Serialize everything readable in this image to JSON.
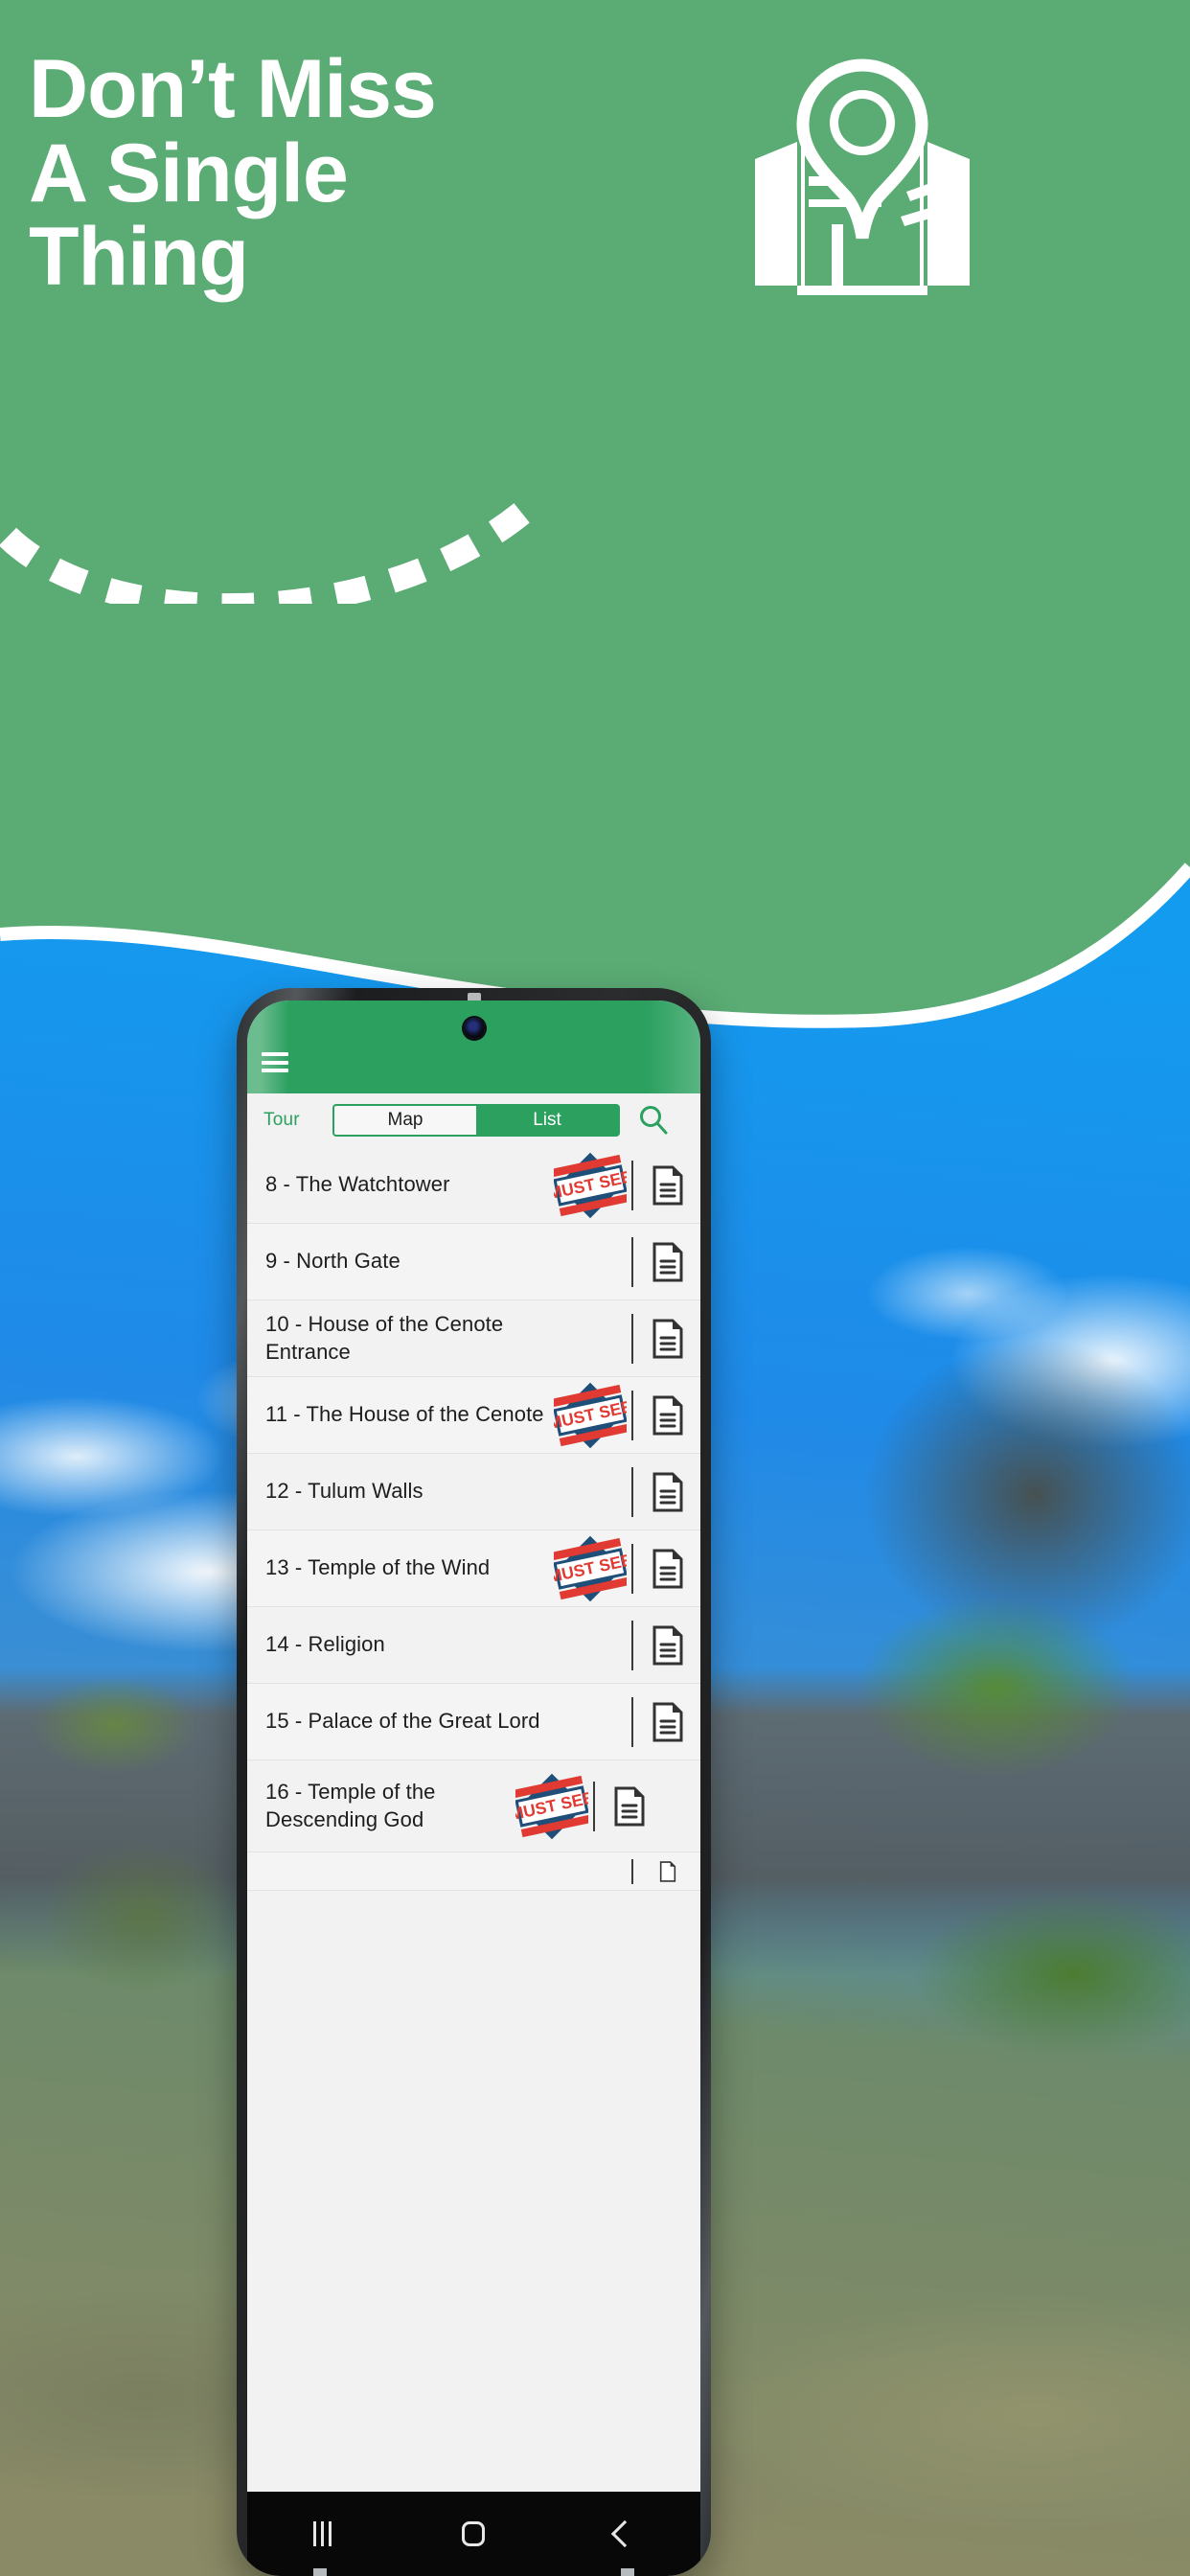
{
  "promo": {
    "headline": "Don’t Miss\nA Single\nThing",
    "background_green": "#5aab74",
    "illustration_icon": "open-book-map-with-location-pin-icon",
    "dashed_arc_icon": "dashed-curve-arc-icon"
  },
  "phone": {
    "app_bar": {
      "background": "#2ba05f",
      "menu_icon": "hamburger-menu-icon",
      "camera_icon": "front-camera-icon"
    },
    "toolbar": {
      "screen_label": "Tour",
      "segments": [
        {
          "label": "Map",
          "selected": true
        },
        {
          "label": "List",
          "selected": false
        }
      ],
      "search_icon": "search-icon"
    },
    "list": {
      "badge_label": "MUST SEE",
      "badge_colors": {
        "diamond": "#1f4e79",
        "banner": "#e03a33",
        "text": "#e03a33"
      },
      "doc_icon": "document-icon",
      "items": [
        {
          "title": "8 - The Watchtower",
          "must_see": true
        },
        {
          "title": "9 - North Gate",
          "must_see": false
        },
        {
          "title": "10 - House of the Cenote Entrance",
          "must_see": false
        },
        {
          "title": "11 - The House of the Cenote",
          "must_see": true
        },
        {
          "title": "12 - Tulum Walls",
          "must_see": false
        },
        {
          "title": "13 - Temple of the Wind",
          "must_see": true
        },
        {
          "title": "14 - Religion",
          "must_see": false
        },
        {
          "title": "15 - Palace of the Great Lord",
          "must_see": false
        },
        {
          "title": "16 - Temple of the Descending God",
          "must_see": true
        }
      ]
    },
    "nav_bar": {
      "recents_icon": "recents-icon",
      "home_icon": "home-icon",
      "back_icon": "back-icon"
    }
  }
}
